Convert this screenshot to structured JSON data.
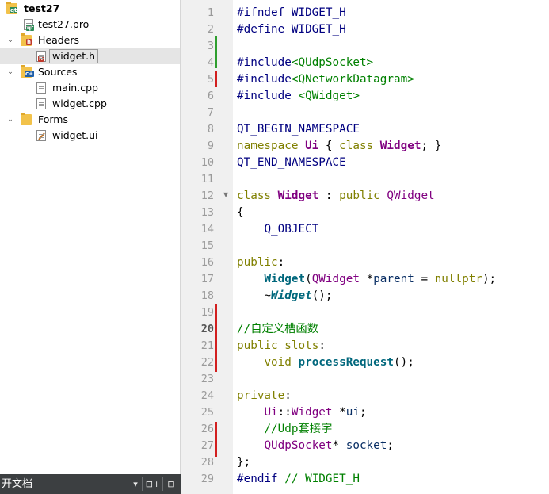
{
  "tree": {
    "project": "test27",
    "pro_file": "test27.pro",
    "headers": "Headers",
    "header_file": "widget.h",
    "sources": "Sources",
    "source_files": [
      "main.cpp",
      "widget.cpp"
    ],
    "forms": "Forms",
    "form_file": "widget.ui"
  },
  "bottom_bar": {
    "label": "开文档",
    "dropdown": "▾",
    "split": "⊟+",
    "close": "⊟"
  },
  "editor": {
    "current_line": 20,
    "lines": [
      [
        [
          "#ifndef WIDGET_H",
          "pp"
        ]
      ],
      [
        [
          "#define WIDGET_H",
          "pp"
        ]
      ],
      [],
      [
        [
          "#include",
          "pp"
        ],
        [
          "<QUdpSocket>",
          "str"
        ]
      ],
      [
        [
          "#include",
          "pp"
        ],
        [
          "<QNetworkDatagram>",
          "str"
        ]
      ],
      [
        [
          "#include ",
          "pp"
        ],
        [
          "<QWidget>",
          "str"
        ]
      ],
      [],
      [
        [
          "QT_BEGIN_NAMESPACE",
          "mac"
        ]
      ],
      [
        [
          "namespace ",
          "kw"
        ],
        [
          "Ui",
          "tyb"
        ],
        [
          " { ",
          ""
        ],
        [
          "class ",
          "kw"
        ],
        [
          "Widget",
          "tyb"
        ],
        [
          "; }",
          ""
        ]
      ],
      [
        [
          "QT_END_NAMESPACE",
          "mac"
        ]
      ],
      [],
      [
        [
          "class ",
          "kw"
        ],
        [
          "Widget",
          "tyb"
        ],
        [
          " : ",
          ""
        ],
        [
          "public ",
          "kw"
        ],
        [
          "QWidget",
          "ty"
        ]
      ],
      [
        [
          "{",
          ""
        ]
      ],
      [
        [
          "    ",
          ""
        ],
        [
          "Q_OBJECT",
          "mac"
        ]
      ],
      [],
      [
        [
          "public",
          "kw"
        ],
        [
          ":",
          ""
        ]
      ],
      [
        [
          "    ",
          ""
        ],
        [
          "Widget",
          "fn"
        ],
        [
          "(",
          ""
        ],
        [
          "QWidget",
          "ty"
        ],
        [
          " *",
          ""
        ],
        [
          "parent",
          "var"
        ],
        [
          " = ",
          ""
        ],
        [
          "nullptr",
          "kw"
        ],
        [
          ");",
          ""
        ]
      ],
      [
        [
          "    ~",
          ""
        ],
        [
          "Widget",
          "fni"
        ],
        [
          "();",
          ""
        ]
      ],
      [],
      [
        [
          "//自定义槽函数",
          "cm"
        ]
      ],
      [
        [
          "public ",
          "kw"
        ],
        [
          "slots",
          "kw"
        ],
        [
          ":",
          ""
        ]
      ],
      [
        [
          "    ",
          ""
        ],
        [
          "void ",
          "kw"
        ],
        [
          "processRequest",
          "fn"
        ],
        [
          "();",
          ""
        ]
      ],
      [],
      [
        [
          "private",
          "kw"
        ],
        [
          ":",
          ""
        ]
      ],
      [
        [
          "    ",
          ""
        ],
        [
          "Ui",
          "ty"
        ],
        [
          "::",
          ""
        ],
        [
          "Widget",
          "ty"
        ],
        [
          " *",
          ""
        ],
        [
          "ui",
          "var"
        ],
        [
          ";",
          ""
        ]
      ],
      [
        [
          "    ",
          ""
        ],
        [
          "//Udp套接字",
          "cm"
        ]
      ],
      [
        [
          "    ",
          ""
        ],
        [
          "QUdpSocket",
          "ty"
        ],
        [
          "* ",
          ""
        ],
        [
          "socket",
          "var"
        ],
        [
          ";",
          ""
        ]
      ],
      [
        [
          "};",
          ""
        ]
      ],
      [
        [
          "#endif ",
          "pp"
        ],
        [
          "// WIDGET_H",
          "cm"
        ]
      ]
    ]
  },
  "colors": {
    "folder": "#f2c24a",
    "change_added": "#2e9e2e",
    "change_modified": "#d21f1f",
    "bottom_bar": "#3c3f41"
  }
}
